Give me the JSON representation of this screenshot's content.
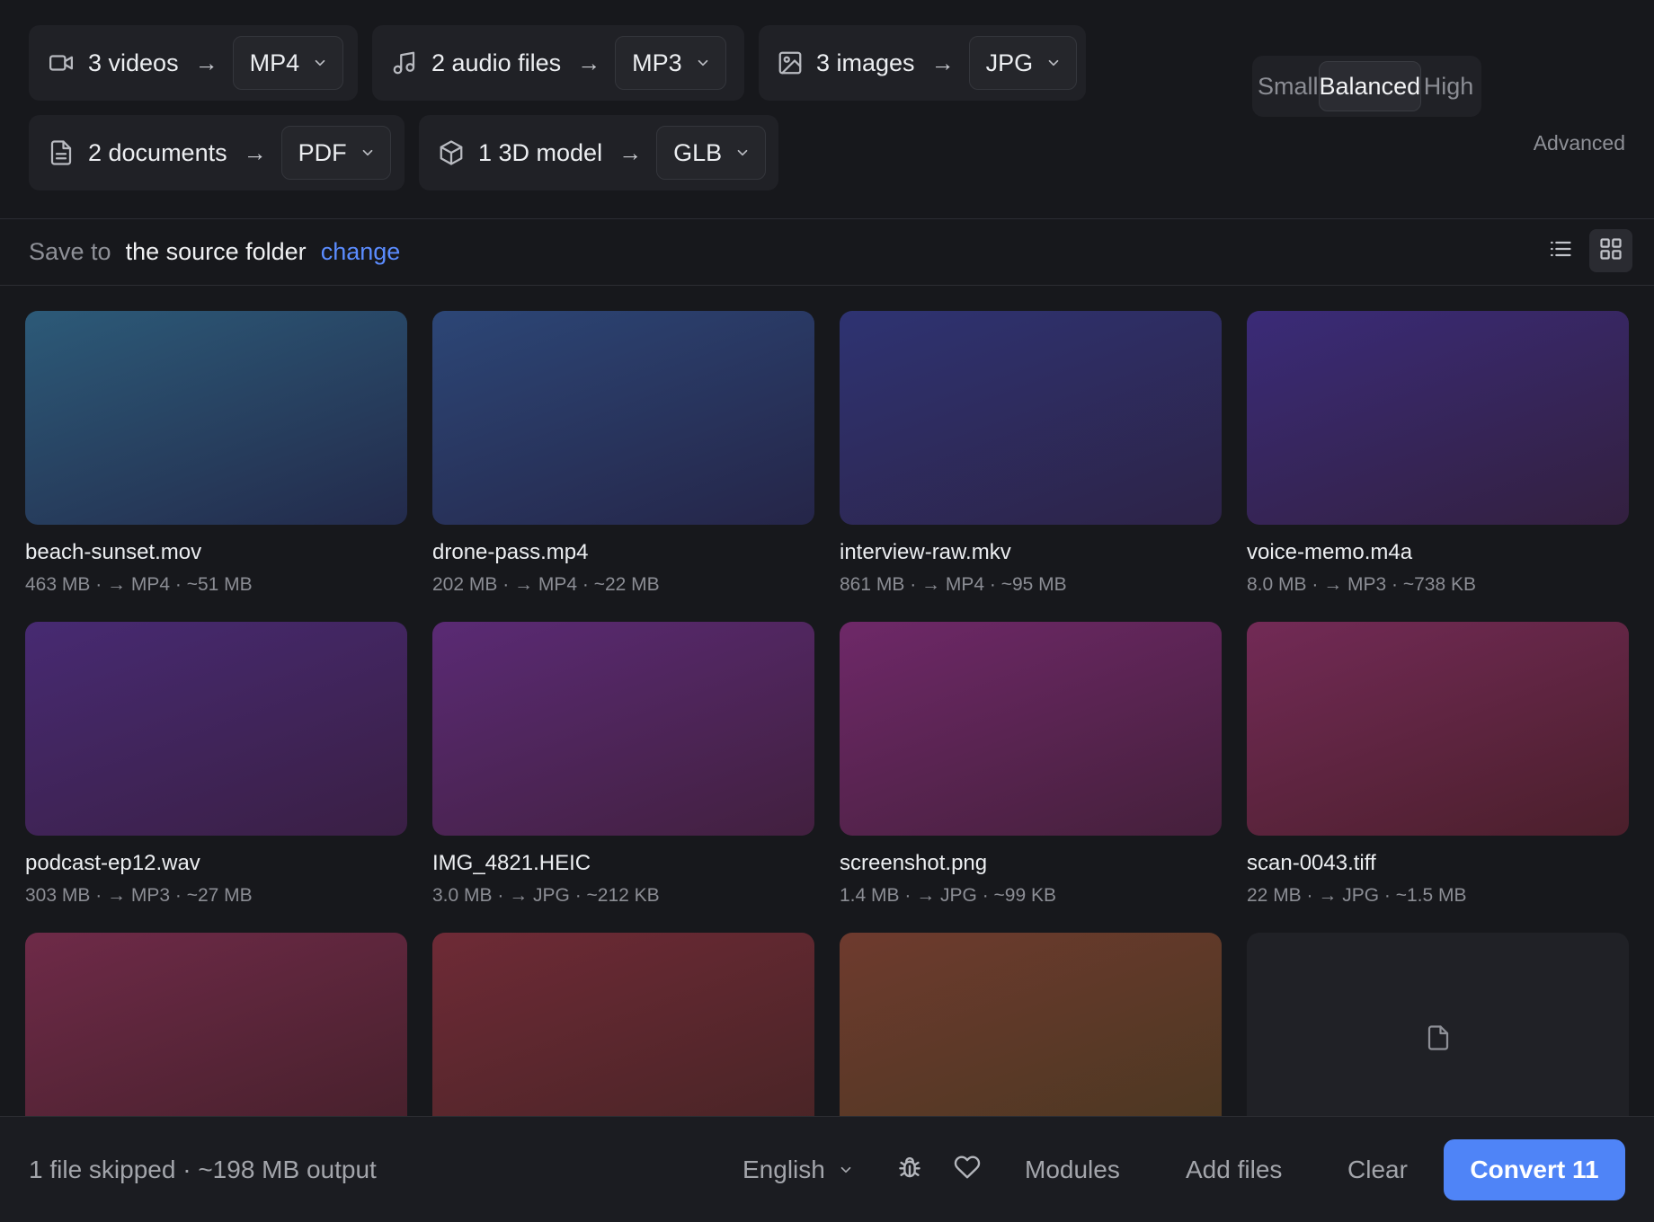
{
  "groups": [
    {
      "icon": "video-camera-icon",
      "label": "3 videos",
      "arrow": "→",
      "format": "MP4"
    },
    {
      "icon": "music-note-icon",
      "label": "2 audio files",
      "arrow": "→",
      "format": "MP3"
    },
    {
      "icon": "image-icon",
      "label": "3 images",
      "arrow": "→",
      "format": "JPG"
    },
    {
      "icon": "document-icon",
      "label": "2 documents",
      "arrow": "→",
      "format": "PDF"
    },
    {
      "icon": "cube-icon",
      "label": "1 3D model",
      "arrow": "→",
      "format": "GLB"
    }
  ],
  "quality": {
    "options": [
      "Small",
      "Balanced",
      "High"
    ],
    "selected": "Balanced",
    "advanced_label": "Advanced"
  },
  "save": {
    "prefix": "Save to",
    "destination": "the source folder",
    "change_label": "change"
  },
  "view": {
    "active": "grid"
  },
  "files": [
    {
      "name": "beach-sunset.mov",
      "meta": "463 MB · → MP4 · ~51 MB",
      "colors": [
        "#2c5a78",
        "#232a4b"
      ]
    },
    {
      "name": "drone-pass.mp4",
      "meta": "202 MB · → MP4 · ~22 MB",
      "colors": [
        "#2c4676",
        "#252548"
      ]
    },
    {
      "name": "interview-raw.mkv",
      "meta": "861 MB · → MP4 · ~95 MB",
      "colors": [
        "#2e3372",
        "#2d2347"
      ]
    },
    {
      "name": "voice-memo.m4a",
      "meta": "8.0 MB · → MP3 · ~738 KB",
      "colors": [
        "#3a2b78",
        "#33203f"
      ]
    },
    {
      "name": "podcast-ep12.wav",
      "meta": "303 MB · → MP3 · ~27 MB",
      "colors": [
        "#472a72",
        "#3a1f44"
      ]
    },
    {
      "name": "IMG_4821.HEIC",
      "meta": "3.0 MB · → JPG · ~212 KB",
      "colors": [
        "#5a2a74",
        "#42203f"
      ]
    },
    {
      "name": "screenshot.png",
      "meta": "1.4 MB · → JPG · ~99 KB",
      "colors": [
        "#6e2868",
        "#45203b"
      ]
    },
    {
      "name": "scan-0043.tiff",
      "meta": "22 MB · → JPG · ~1.5 MB",
      "colors": [
        "#722a56",
        "#4b1f2b"
      ]
    },
    {
      "name": "",
      "meta": "",
      "colors": [
        "#6e2a48",
        "#45202a"
      ]
    },
    {
      "name": "",
      "meta": "",
      "colors": [
        "#6e2a36",
        "#472425"
      ]
    },
    {
      "name": "",
      "meta": "",
      "colors": [
        "#6e3a2e",
        "#4a3821"
      ]
    },
    {
      "name": "",
      "meta": "",
      "placeholder": true
    }
  ],
  "footer": {
    "status": "1 file skipped · ~198 MB output",
    "language": "English",
    "modules_label": "Modules",
    "add_files_label": "Add files",
    "clear_label": "Clear",
    "convert_label": "Convert 11"
  },
  "colors": {
    "accent": "#4f84f7",
    "link": "#5b8cff",
    "background": "#17181c"
  }
}
